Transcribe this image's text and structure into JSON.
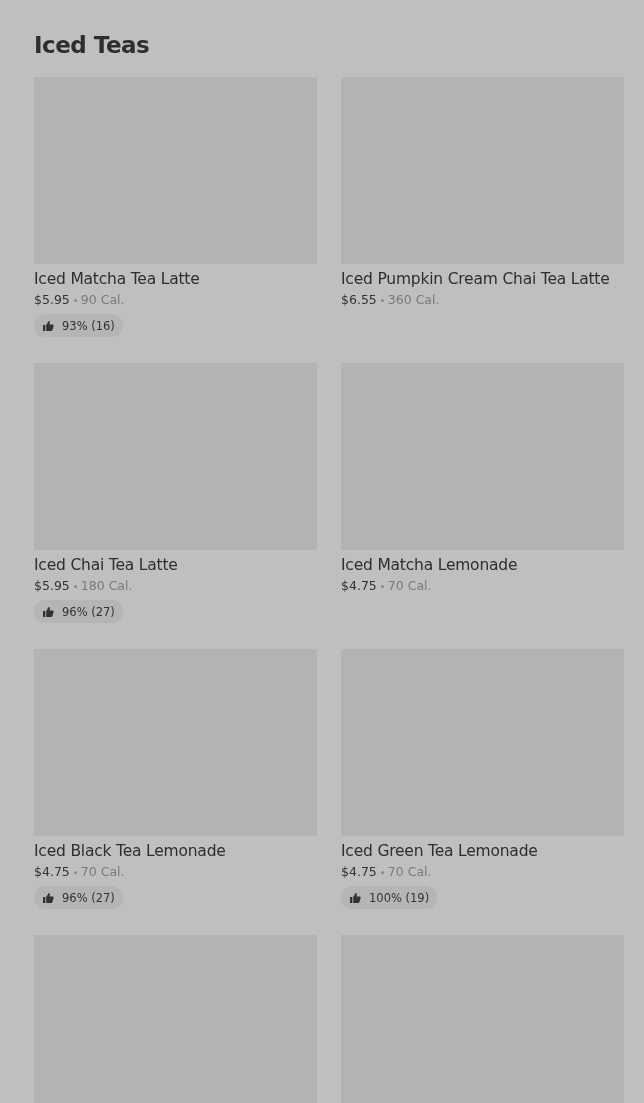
{
  "section": {
    "title": "Iced Teas"
  },
  "items": [
    {
      "kind": "full",
      "name": "Iced Matcha Tea Latte",
      "price": "$5.95",
      "calories": "90 Cal.",
      "rating": "93% (16)"
    },
    {
      "kind": "full",
      "name": "Iced Pumpkin Cream Chai Tea Latte",
      "price": "$6.55",
      "calories": "360 Cal."
    },
    {
      "kind": "full",
      "name": "Iced Chai Tea Latte",
      "price": "$5.95",
      "calories": "180 Cal.",
      "rating": "96% (27)"
    },
    {
      "kind": "full",
      "name": "Iced Matcha Lemonade",
      "price": "$4.75",
      "calories": "70 Cal."
    },
    {
      "kind": "full",
      "name": "Iced Black Tea Lemonade",
      "price": "$4.75",
      "calories": "70 Cal.",
      "rating": "96% (27)"
    },
    {
      "kind": "full",
      "name": "Iced Green Tea Lemonade",
      "price": "$4.75",
      "calories": "70 Cal.",
      "rating": "100% (19)"
    },
    {
      "kind": "image-only"
    },
    {
      "kind": "image-only"
    }
  ]
}
